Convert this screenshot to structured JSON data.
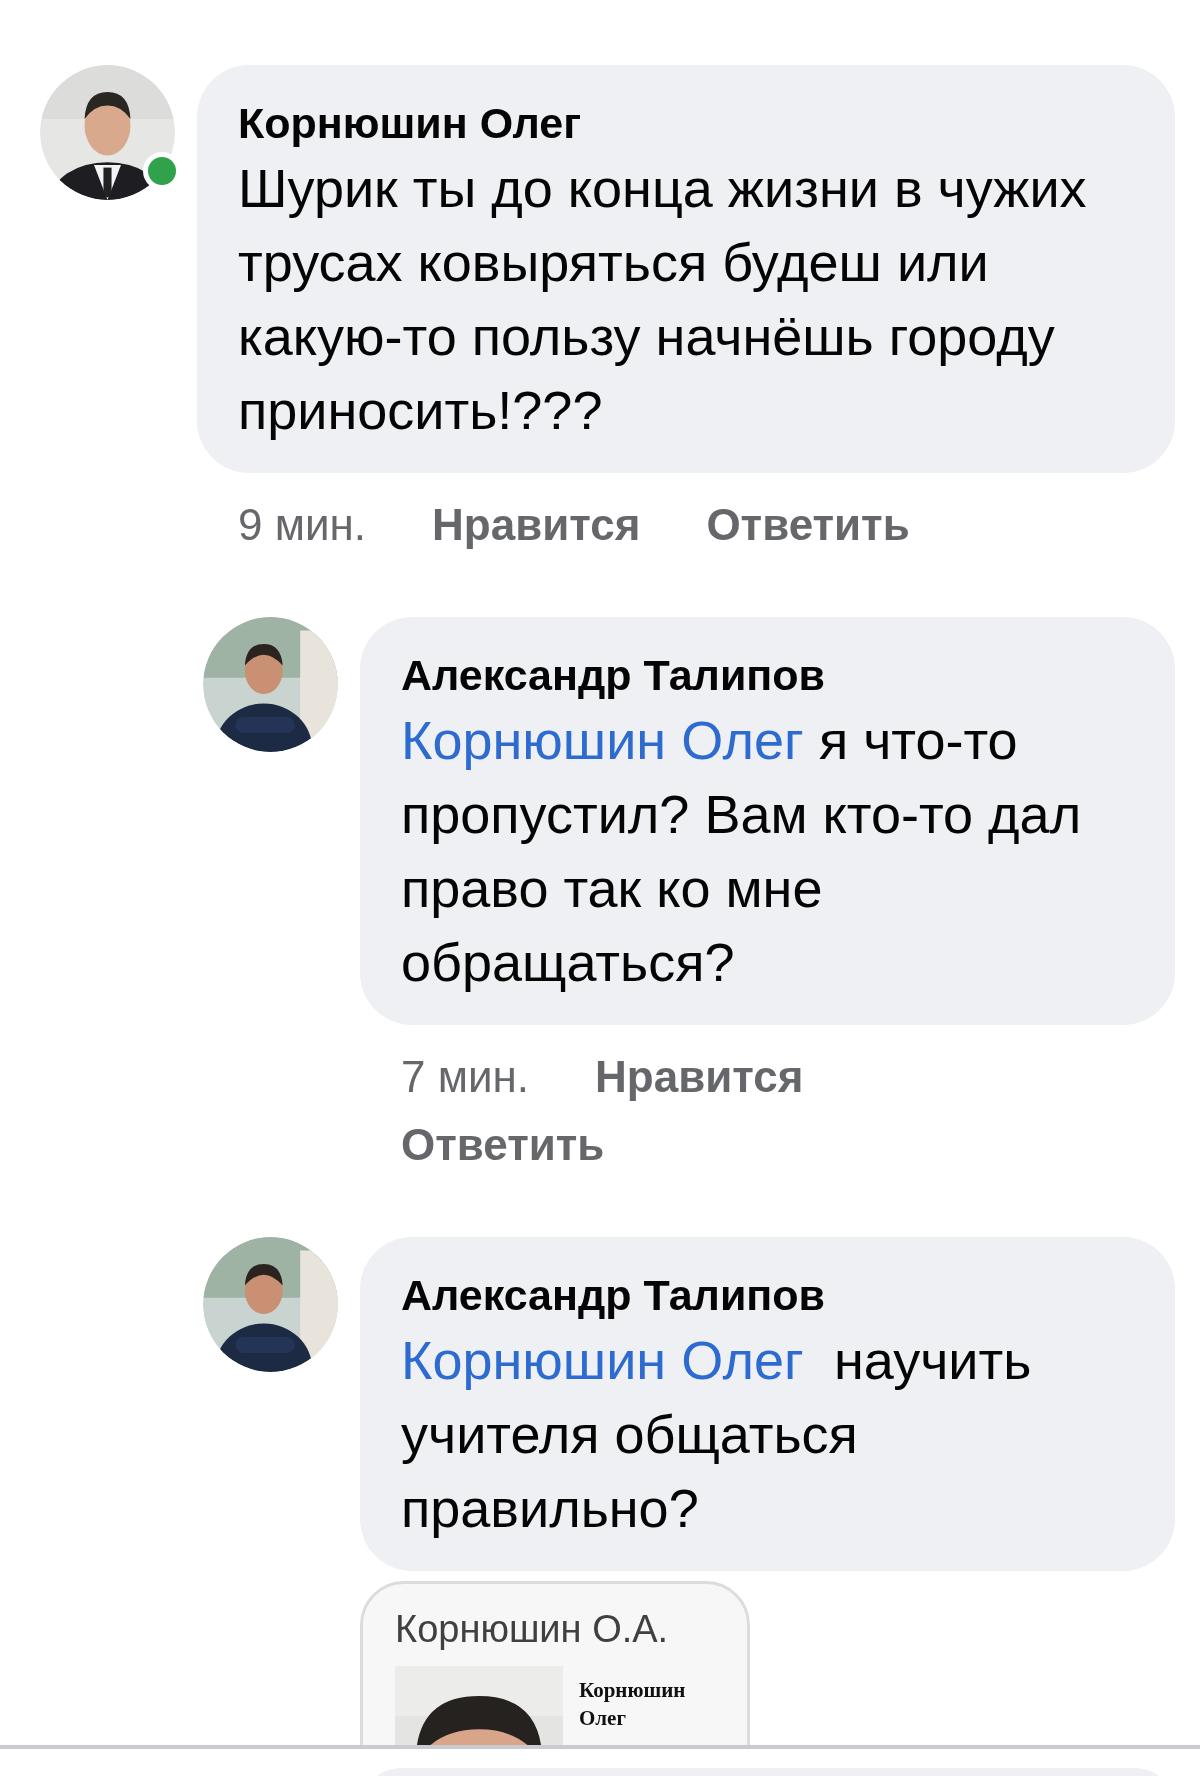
{
  "comments": [
    {
      "author": "Корнюшин Олег",
      "online": true,
      "text": "Шурик ты до конца жизни в чужих трусах ковыряться будеш или какую-то пользу начнёшь городу приносить!???",
      "actions": {
        "time": "9 мин.",
        "like": "Нравится",
        "reply": "Ответить"
      },
      "replies": [
        {
          "author": "Александр Талипов",
          "mention": "Корнюшин Олег",
          "text": "я что-то пропустил? Вам кто-то дал право так ко мне обращаться?",
          "actions": {
            "time": "7 мин.",
            "like": "Нравится",
            "reply": "Ответить"
          }
        },
        {
          "author": "Александр Талипов",
          "mention": "Корнюшин Олег",
          "text": " научить учителя общаться правильно?",
          "link_preview": {
            "title": "Корнюшин О.А.",
            "caption": "Корнюшин Олег"
          }
        }
      ]
    }
  ]
}
